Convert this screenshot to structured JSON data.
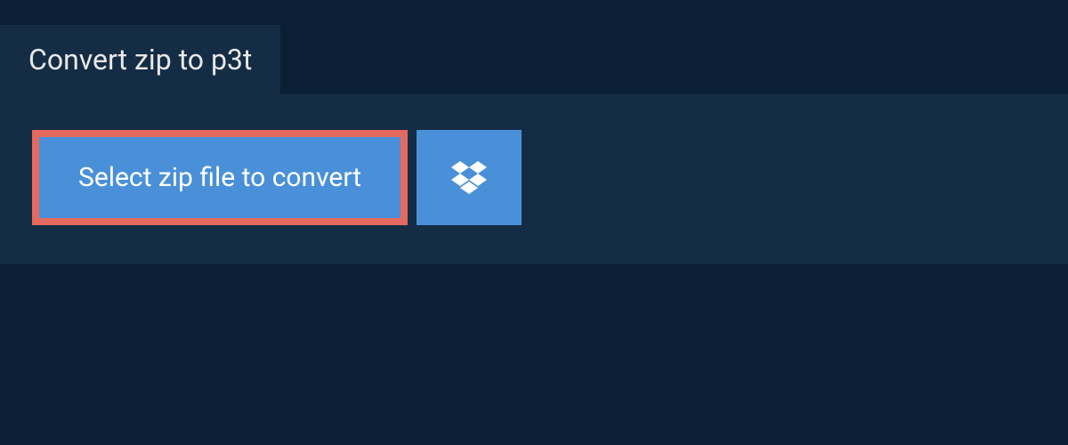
{
  "header": {
    "title": "Convert zip to p3t"
  },
  "actions": {
    "select_file_label": "Select zip file to convert",
    "dropbox_icon_name": "dropbox-icon"
  },
  "colors": {
    "background": "#0a1f33",
    "panel": "#152c45",
    "button_primary": "#4a90d9",
    "button_border_highlight": "#e4695e",
    "text_light": "#e8e8e8",
    "text_white": "#ffffff"
  }
}
